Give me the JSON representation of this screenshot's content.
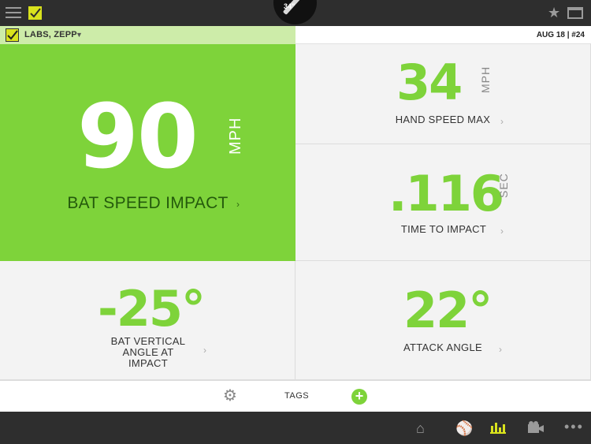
{
  "topbar": {
    "bat_length": "34\"",
    "icons": {
      "menu": "hamburger-icon",
      "logo": "zepp-logo-icon",
      "favorite": "star-icon",
      "calendar": "calendar-icon"
    }
  },
  "player": {
    "name": "LABS, ZEPP"
  },
  "session": {
    "date": "AUG 18 | #24"
  },
  "metrics": {
    "bat_speed": {
      "value": "90",
      "unit": "MPH",
      "label": "BAT SPEED IMPACT"
    },
    "hand_speed": {
      "value": "34",
      "unit": "MPH",
      "label": "HAND SPEED MAX"
    },
    "time_to_impact": {
      "value": ".116",
      "unit": "SEC",
      "label": "TIME TO IMPACT"
    },
    "vertical_angle": {
      "value": "-25°",
      "label_line1": "BAT VERTICAL",
      "label_line2": "ANGLE AT",
      "label_line3": "IMPACT"
    },
    "attack_angle": {
      "value": "22°",
      "label": "ATTACK ANGLE"
    }
  },
  "tags": {
    "label": "TAGS"
  },
  "colors": {
    "accent": "#7ed33a",
    "hero_bg": "#7ed33a",
    "topbar": "#2e2e2e",
    "logo": "#d9e21d",
    "nav_active": "#d9e21d"
  },
  "bottomnav": {
    "items": [
      "home-icon",
      "swing-icon",
      "stats-icon",
      "video-icon",
      "more-icon"
    ],
    "active": "stats-icon"
  }
}
